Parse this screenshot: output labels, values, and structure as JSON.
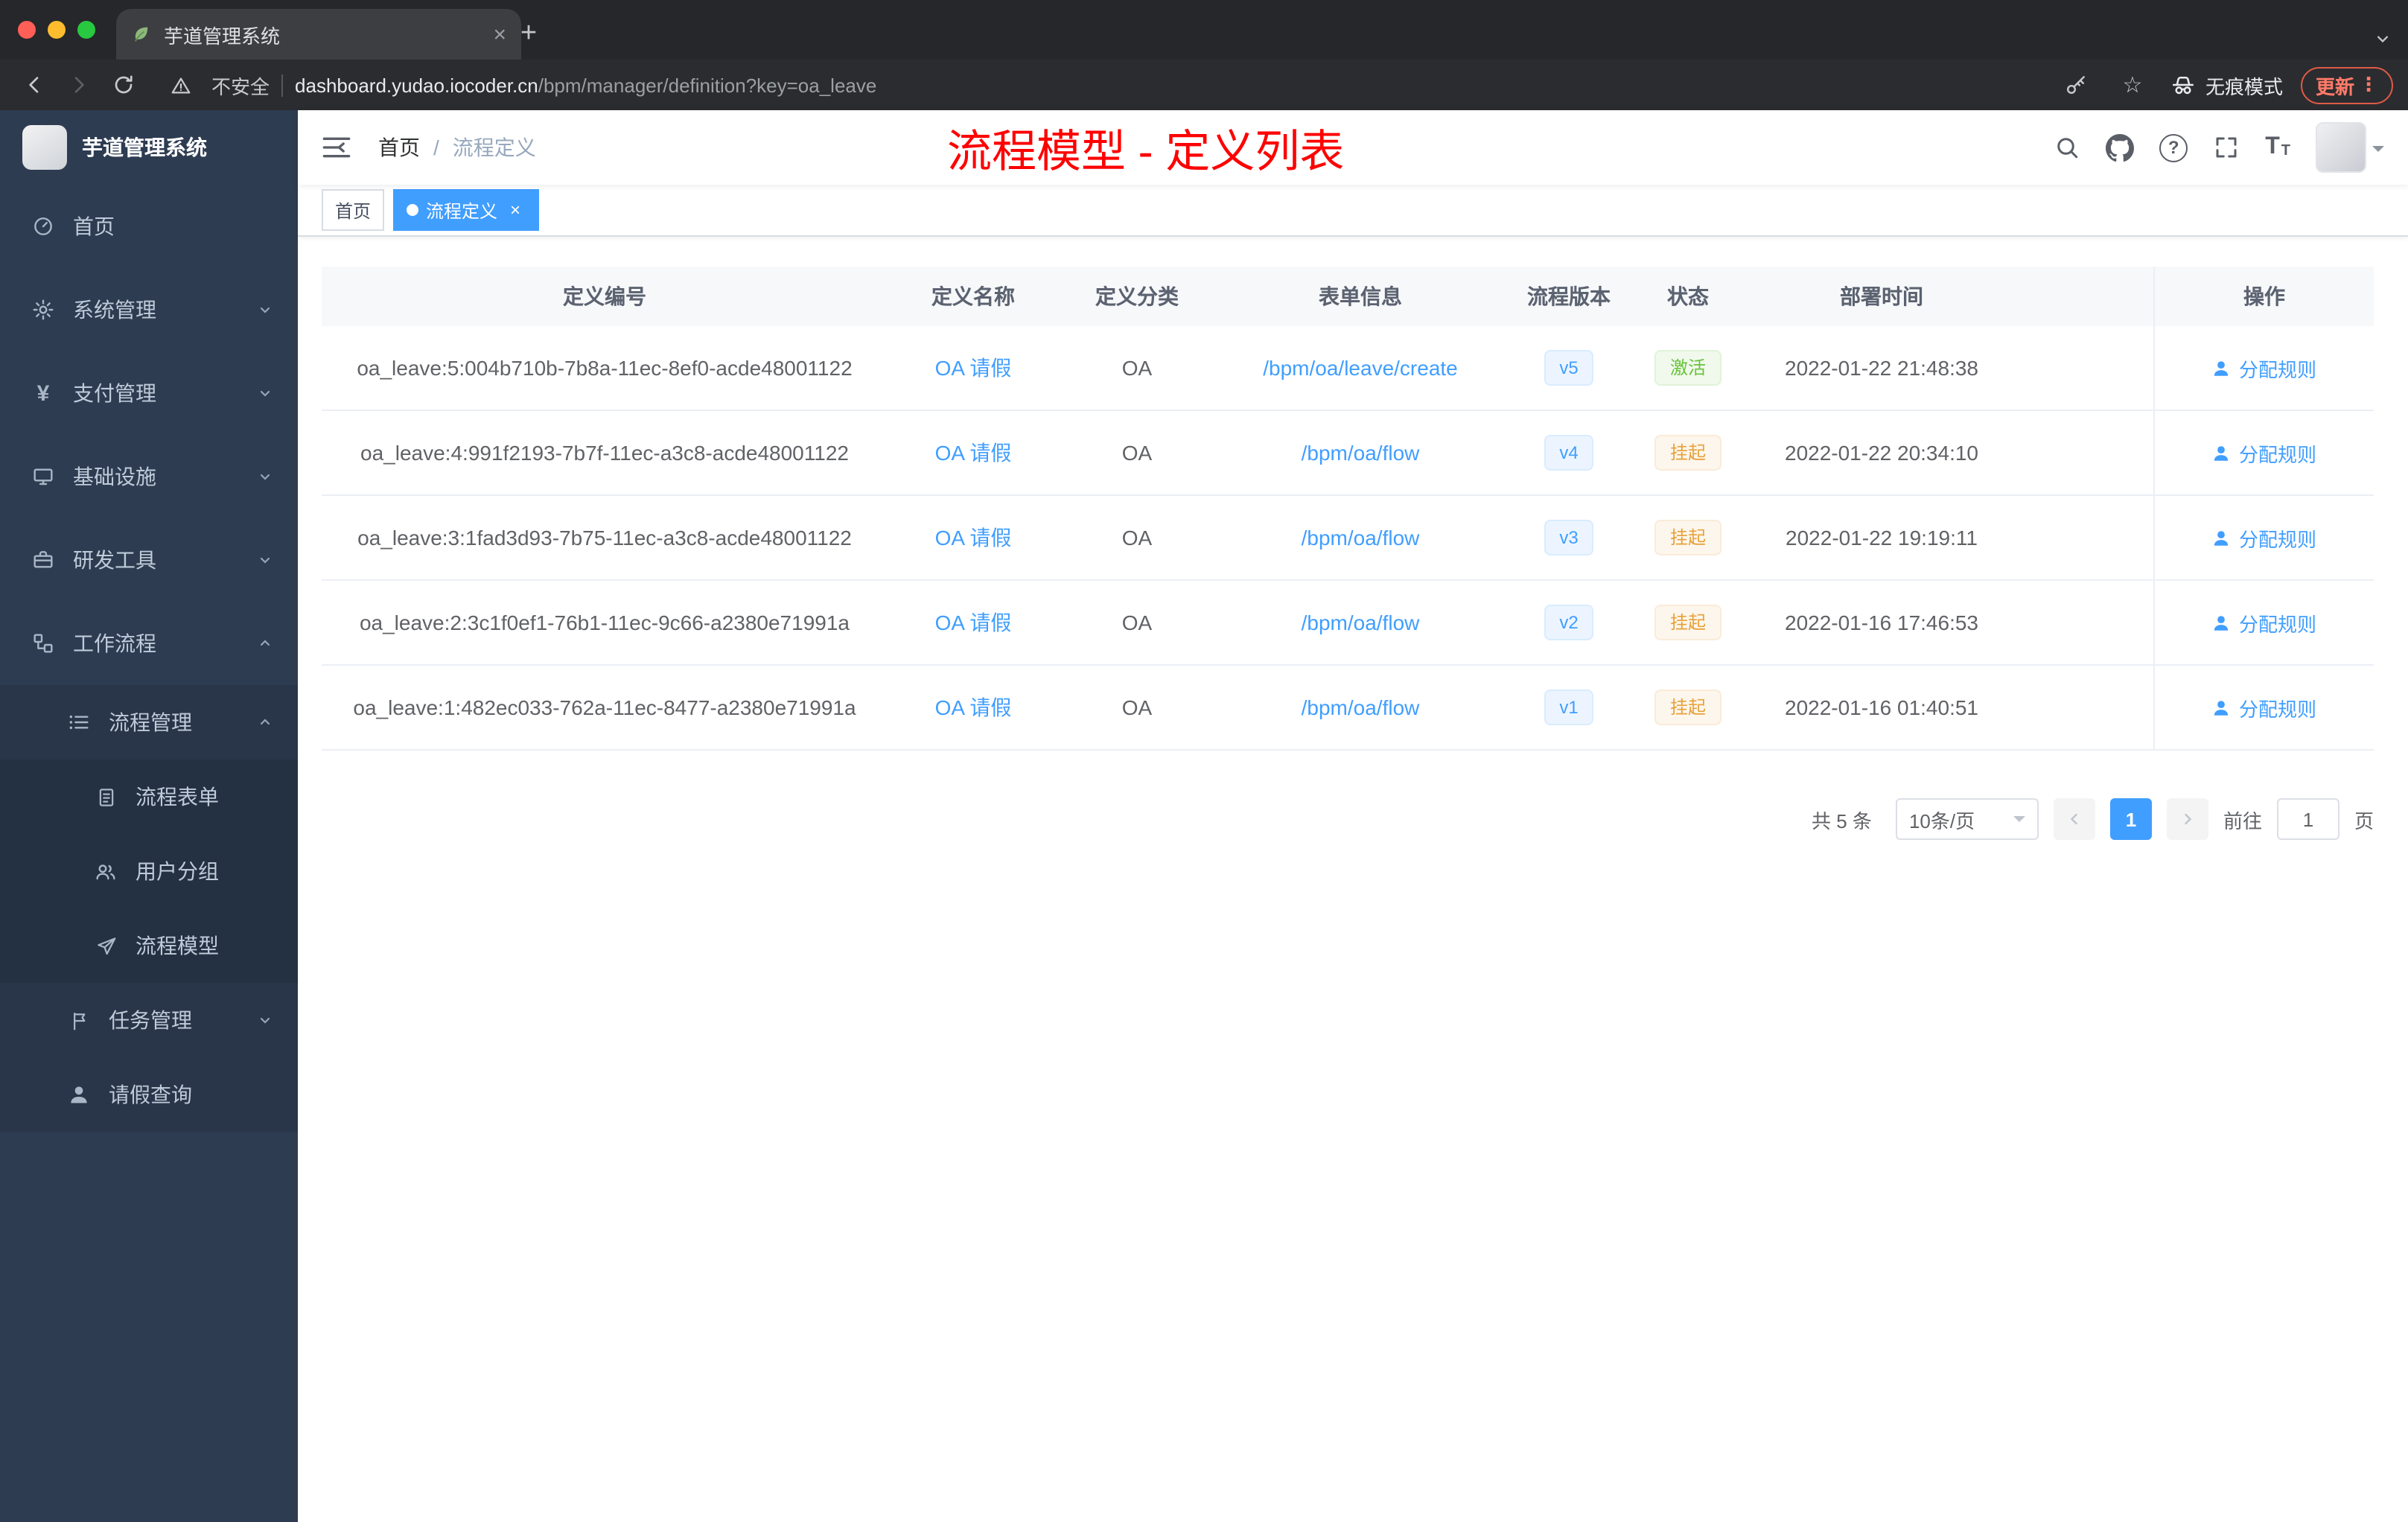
{
  "colors": {
    "accent": "#409eff",
    "success": "#67c23a",
    "warning": "#e6a23c",
    "annotation_red": "#fe0000",
    "sidebar_bg": "#2e3c52"
  },
  "icons": {
    "close": "×",
    "plus": "+",
    "overflow": "⋮",
    "star": "☆",
    "help": "?",
    "font_large": "T",
    "font_small": "T",
    "yen": "¥"
  },
  "browser": {
    "tab_title": "芋道管理系统",
    "security_label": "不安全",
    "url_host": "dashboard.yudao.iocoder.cn",
    "url_path": "/bpm/manager/definition?key=oa_leave",
    "incognito_label": "无痕模式",
    "update_label": "更新"
  },
  "sidebar": {
    "logo_title": "芋道管理系统",
    "items": [
      {
        "label": "首页"
      },
      {
        "label": "系统管理"
      },
      {
        "label": "支付管理"
      },
      {
        "label": "基础设施"
      },
      {
        "label": "研发工具"
      },
      {
        "label": "工作流程"
      },
      {
        "label": "流程管理"
      },
      {
        "label": "流程表单"
      },
      {
        "label": "用户分组"
      },
      {
        "label": "流程模型"
      },
      {
        "label": "任务管理"
      },
      {
        "label": "请假查询"
      }
    ]
  },
  "header": {
    "breadcrumb_home": "首页",
    "breadcrumb_separator": "/",
    "breadcrumb_current": "流程定义",
    "annotation": "流程模型 - 定义列表"
  },
  "tags": {
    "home_label": "首页",
    "active_label": "流程定义"
  },
  "table": {
    "columns": [
      "定义编号",
      "定义名称",
      "定义分类",
      "表单信息",
      "流程版本",
      "状态",
      "部署时间",
      "操作"
    ],
    "rows": [
      {
        "id": "oa_leave:5:004b710b-7b8a-11ec-8ef0-acde48001122",
        "name": "OA 请假",
        "category": "OA",
        "form": "/bpm/oa/leave/create",
        "version": "v5",
        "status": "激活",
        "status_type": "success",
        "deploy_time": "2022-01-22 21:48:38",
        "action": "分配规则"
      },
      {
        "id": "oa_leave:4:991f2193-7b7f-11ec-a3c8-acde48001122",
        "name": "OA 请假",
        "category": "OA",
        "form": "/bpm/oa/flow",
        "version": "v4",
        "status": "挂起",
        "status_type": "warning",
        "deploy_time": "2022-01-22 20:34:10",
        "action": "分配规则"
      },
      {
        "id": "oa_leave:3:1fad3d93-7b75-11ec-a3c8-acde48001122",
        "name": "OA 请假",
        "category": "OA",
        "form": "/bpm/oa/flow",
        "version": "v3",
        "status": "挂起",
        "status_type": "warning",
        "deploy_time": "2022-01-22 19:19:11",
        "action": "分配规则"
      },
      {
        "id": "oa_leave:2:3c1f0ef1-76b1-11ec-9c66-a2380e71991a",
        "name": "OA 请假",
        "category": "OA",
        "form": "/bpm/oa/flow",
        "version": "v2",
        "status": "挂起",
        "status_type": "warning",
        "deploy_time": "2022-01-16 17:46:53",
        "action": "分配规则"
      },
      {
        "id": "oa_leave:1:482ec033-762a-11ec-8477-a2380e71991a",
        "name": "OA 请假",
        "category": "OA",
        "form": "/bpm/oa/flow",
        "version": "v1",
        "status": "挂起",
        "status_type": "warning",
        "deploy_time": "2022-01-16 01:40:51",
        "action": "分配规则"
      }
    ]
  },
  "pagination": {
    "total": "共 5 条",
    "page_size": "10条/页",
    "current_page": "1",
    "goto_label": "前往",
    "goto_value": "1",
    "page_unit": "页"
  }
}
